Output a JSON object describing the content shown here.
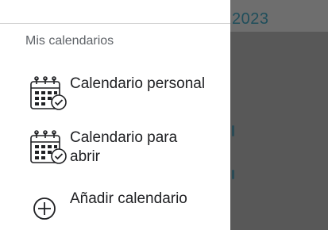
{
  "background": {
    "year_text": "2023"
  },
  "drawer": {
    "section_title": "Mis calendarios",
    "items": [
      {
        "label": "Calendario personal",
        "icon": "calendar-check-icon"
      },
      {
        "label": "Calendario para abrir",
        "icon": "calendar-check-icon"
      },
      {
        "label": "Añadir calendario",
        "icon": "add-circle-icon"
      }
    ]
  },
  "colors": {
    "overlay": "#585858",
    "year_text": "#1f4e5b",
    "divider": "#cfcfcf",
    "section_title": "#5f6368",
    "item_text": "#202124"
  }
}
